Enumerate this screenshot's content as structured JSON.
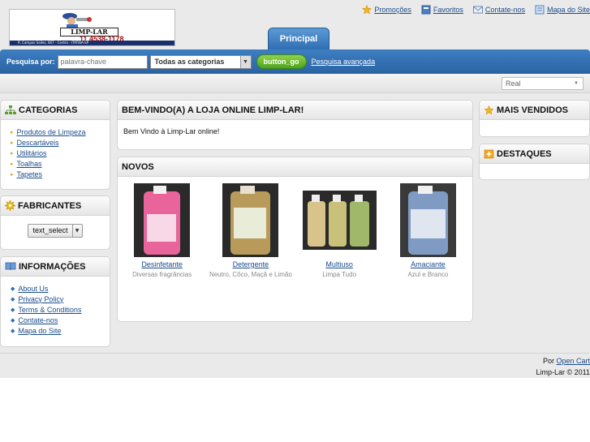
{
  "header": {
    "logo": {
      "brand": "LIMP-LAR",
      "phone": "11 4538-1178",
      "address": "R. Campos Salles, 667 - Centro - ITATIBA-SP"
    },
    "top_links": [
      {
        "label": "Promoções",
        "icon": "star-icon"
      },
      {
        "label": "Favoritos",
        "icon": "bookmark-icon"
      },
      {
        "label": "Contate-nos",
        "icon": "envelope-icon"
      },
      {
        "label": "Mapa do Site",
        "icon": "sitemap-icon"
      }
    ],
    "tab": "Principal"
  },
  "search": {
    "label": "Pesquisa por:",
    "placeholder": "palavra-chave",
    "category": "Todas as categorias",
    "button": "button_go",
    "advanced": "Pesquisa avançada"
  },
  "currency": {
    "selected": "Real"
  },
  "left": {
    "categories": {
      "title": "CATEGORIAS",
      "items": [
        "Produtos de Limpeza",
        "Descartáveis",
        "Utilitários",
        "Toalhas",
        "Tapetes"
      ]
    },
    "manufacturers": {
      "title": "FABRICANTES",
      "select": "text_select"
    },
    "information": {
      "title": "INFORMAÇÕES",
      "items": [
        "About Us",
        "Privacy Policy",
        "Terms & Conditions",
        "Contate-nos",
        "Mapa do Site"
      ]
    }
  },
  "center": {
    "welcome_title": "BEM-VINDO(A) A LOJA ONLINE LIMP-LAR!",
    "welcome_text": "Bem Vindo à Limp-Lar online!",
    "new_title": "NOVOS",
    "products": [
      {
        "name": "Desinfetante",
        "desc": "Diversas fragrâncias",
        "color": "#e8649a"
      },
      {
        "name": "Detergente",
        "desc": "Neutro, Côco, Maçã e Limão",
        "color": "#b89a5a"
      },
      {
        "name": "Multiuso",
        "desc": "Limpa Tudo",
        "color": "#c9c07a"
      },
      {
        "name": "Amaciante",
        "desc": "Azul e Branco",
        "color": "#7f9bc4"
      }
    ]
  },
  "right": {
    "bestsellers_title": "MAIS VENDIDOS",
    "featured_title": "DESTAQUES"
  },
  "footer": {
    "powered_prefix": "Por",
    "powered_link": "Open Cart",
    "copyright": "Limp-Lar © 2011"
  },
  "colors": {
    "accent_blue": "#2f6eb2",
    "go_green": "#5db42a",
    "link": "#1a4b8c"
  }
}
